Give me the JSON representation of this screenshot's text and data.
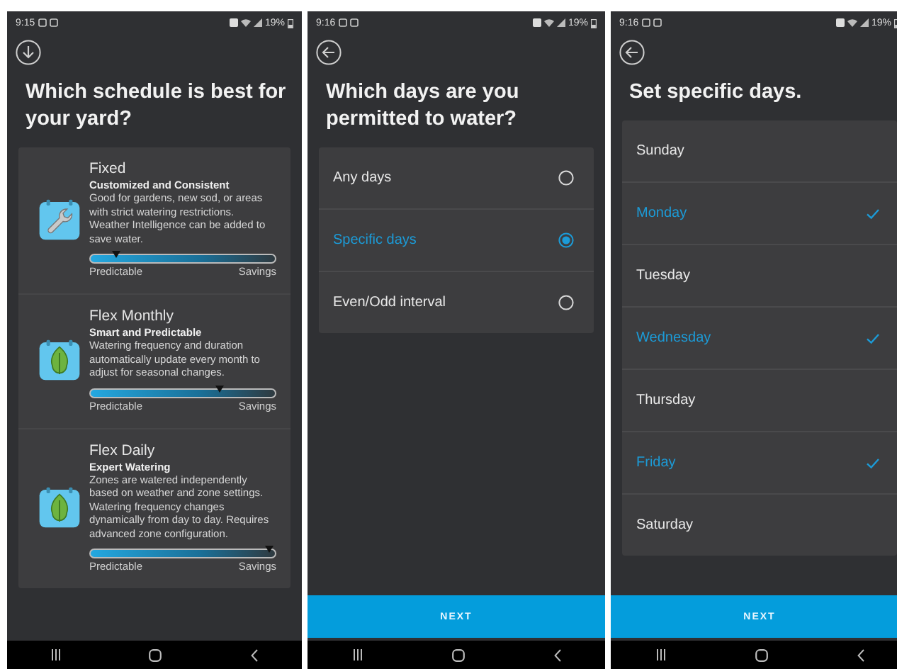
{
  "screens": [
    {
      "kind": "schedules",
      "status": {
        "time": "9:15",
        "battery": "19%"
      },
      "header_button": {
        "kind": "down"
      },
      "title": "Which schedule is best for your yard?",
      "schedules": [
        {
          "kind": "wrench",
          "name": "Fixed",
          "subtitle": "Customized and Consistent",
          "description": "Good for gardens, new sod, or areas with strict watering restrictions. Weather Intelligence can be added to save water.",
          "level": 0.14,
          "left_label": "Predictable",
          "right_label": "Savings"
        },
        {
          "kind": "leaf",
          "name": "Flex Monthly",
          "subtitle": "Smart and Predictable",
          "description": "Watering frequency and duration automatically update every month to adjust for seasonal changes.",
          "level": 0.7,
          "left_label": "Predictable",
          "right_label": "Savings"
        },
        {
          "kind": "leaf",
          "name": "Flex Daily",
          "subtitle": "Expert Watering",
          "description": "Zones are watered independently based on weather and zone settings. Watering frequency changes dynamically from day to day. Requires advanced zone configuration.",
          "level": 0.97,
          "left_label": "Predictable",
          "right_label": "Savings"
        }
      ]
    },
    {
      "kind": "options",
      "status": {
        "time": "9:16",
        "battery": "19%"
      },
      "header_button": {
        "kind": "back"
      },
      "title": "Which days are you permitted to water?",
      "options": [
        {
          "label": "Any days",
          "selected": false
        },
        {
          "label": "Specific days",
          "selected": true
        },
        {
          "label": "Even/Odd interval",
          "selected": false
        }
      ],
      "next_button": "NEXT"
    },
    {
      "kind": "days",
      "status": {
        "time": "9:16",
        "battery": "19%"
      },
      "header_button": {
        "kind": "back"
      },
      "title": "Set specific days.",
      "days": [
        {
          "label": "Sunday",
          "selected": false
        },
        {
          "label": "Monday",
          "selected": true
        },
        {
          "label": "Tuesday",
          "selected": false
        },
        {
          "label": "Wednesday",
          "selected": true
        },
        {
          "label": "Thursday",
          "selected": false
        },
        {
          "label": "Friday",
          "selected": true
        },
        {
          "label": "Saturday",
          "selected": false
        }
      ],
      "next_button": "NEXT"
    }
  ]
}
